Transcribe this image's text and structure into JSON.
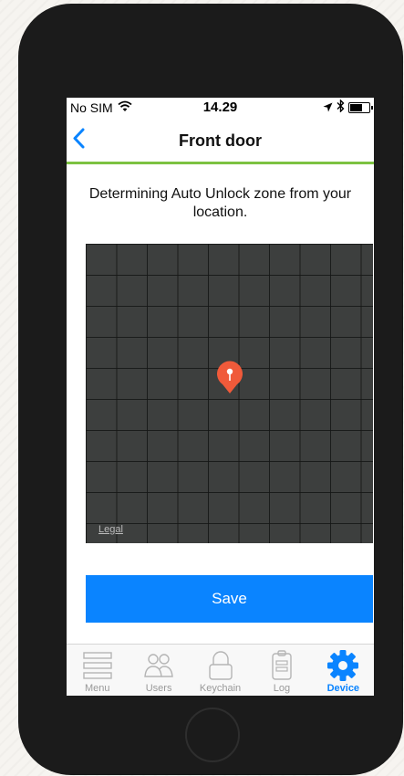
{
  "status_bar": {
    "carrier": "No SIM",
    "time": "14.29",
    "battery_level": 0.6
  },
  "nav": {
    "title": "Front door",
    "back_icon": "chevron-left-icon"
  },
  "content": {
    "info_text": "Determining Auto Unlock zone from your location.",
    "map_legal": "Legal",
    "save_label": "Save"
  },
  "tabs": [
    {
      "label": "Menu",
      "icon": "menu-icon",
      "active": false
    },
    {
      "label": "Users",
      "icon": "users-icon",
      "active": false
    },
    {
      "label": "Keychain",
      "icon": "lock-icon",
      "active": false
    },
    {
      "label": "Log",
      "icon": "clipboard-icon",
      "active": false
    },
    {
      "label": "Device",
      "icon": "gear-icon",
      "active": true
    }
  ],
  "colors": {
    "accent": "#0a84ff",
    "nav_underline": "#7cc242",
    "pin": "#f05a3a",
    "map_background": "#3d3f3e"
  }
}
